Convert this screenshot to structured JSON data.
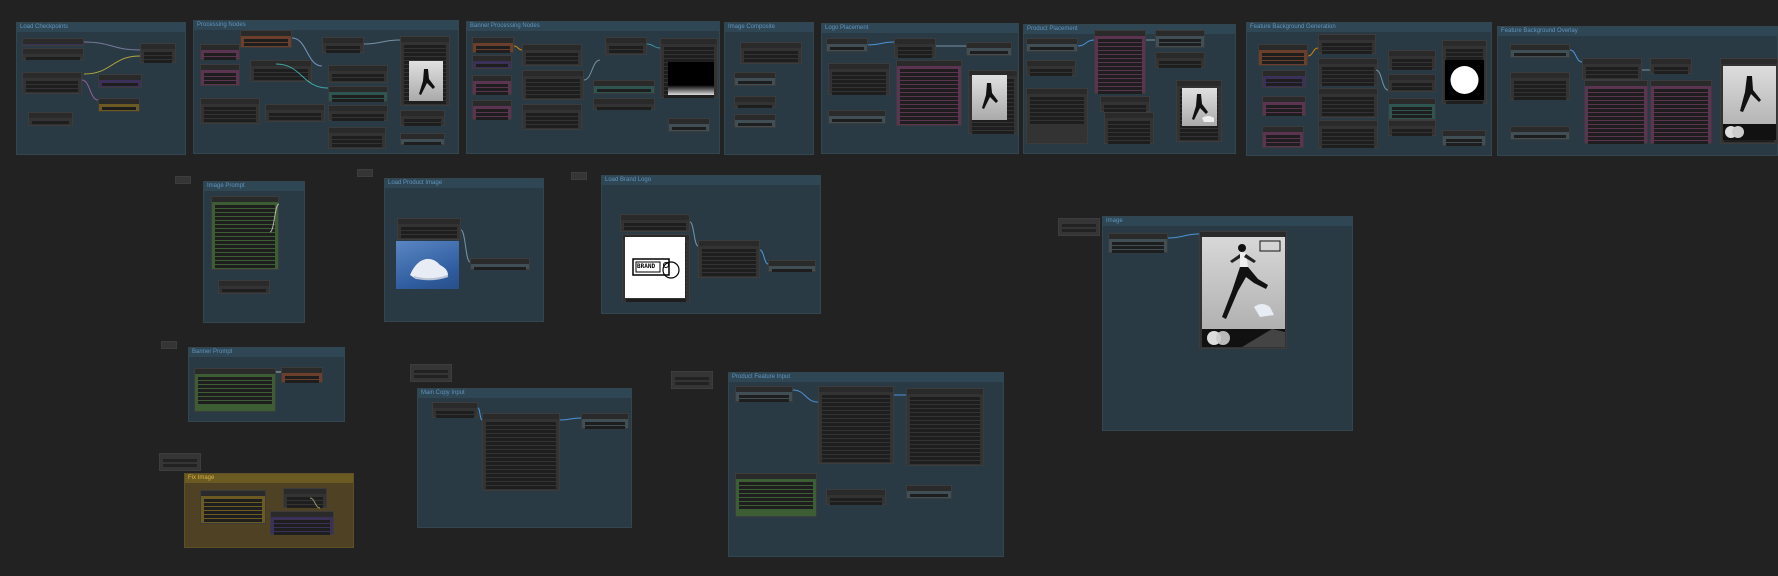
{
  "canvas": {
    "app": "ComfyUI workflow"
  },
  "groups": {
    "load_checkpoints": "Load Checkpoints",
    "processing_nodes": "Processing Nodes",
    "banner_processing_nodes": "Banner Processing Nodes",
    "image_composite": "Image Composite",
    "logo_placement": "Logo Placement",
    "product_placement": "Product Placement",
    "feature_background_generation": "Feature Background Generation",
    "feature_background_overlay": "Feature Background Overlay",
    "image_prompt": "Image Prompt",
    "load_product_image": "Load Product Image",
    "load_brand_logo": "Load Brand Logo",
    "image": "Image",
    "banner_prompt": "Banner Prompt",
    "main_copy_input": "Main Copy Input",
    "product_feature_input": "Product Feature Input",
    "fix_image": "Fix Image"
  },
  "logo": {
    "text": "BRAND"
  },
  "colors": {
    "group_bg": "#2a3a44",
    "group_title": "#5f95bd",
    "fix_image_group": "#4f4224",
    "canvas_bg": "#222222"
  }
}
